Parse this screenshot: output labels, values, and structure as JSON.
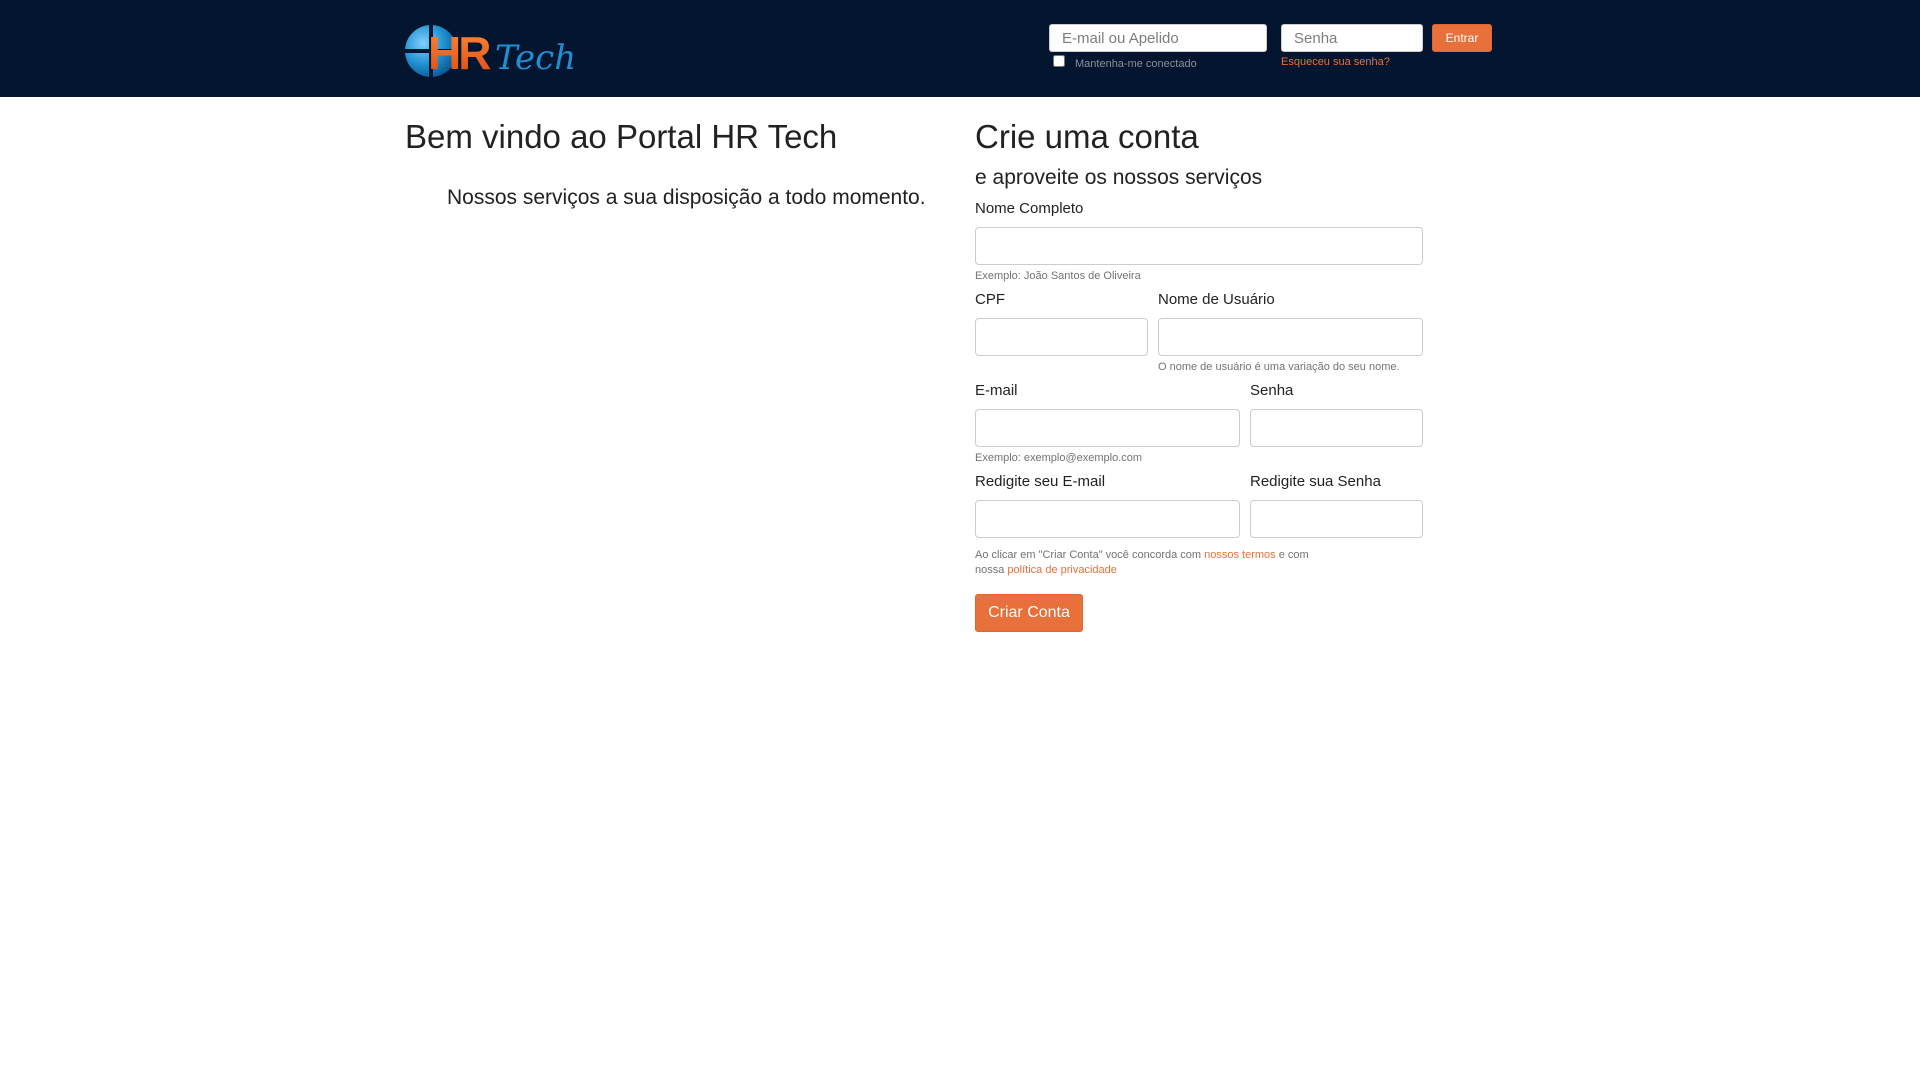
{
  "header": {
    "logo_text": "HRTech",
    "email_placeholder": "E-mail ou Apelido",
    "password_placeholder": "Senha",
    "login_button": "Entrar",
    "remember_label": "Mantenha-me conectado",
    "forgot_link": "Esqueceu sua senha?"
  },
  "welcome": {
    "title": "Bem vindo ao Portal HR Tech",
    "text": "Nossos serviços a sua disposição a todo momento."
  },
  "signup": {
    "title": "Crie uma conta",
    "subtitle": "e aproveite os nossos serviços",
    "full_name": {
      "label": "Nome Completo",
      "help": "Exemplo: João Santos de Oliveira"
    },
    "cpf": {
      "label": "CPF"
    },
    "username": {
      "label": "Nome de Usuário",
      "help": "O nome de usuário é uma variação do seu nome."
    },
    "email": {
      "label": "E-mail",
      "help": "Exemplo: exemplo@exemplo.com"
    },
    "password": {
      "label": "Senha"
    },
    "email_confirm": {
      "label": "Redigite seu E-mail"
    },
    "password_confirm": {
      "label": "Redigite sua Senha"
    },
    "terms": {
      "prefix": "Ao clicar em \"Criar Conta\" você concorda com ",
      "terms_link": "nossos termos",
      "middle": " e com nossa ",
      "privacy_link": "política de privacidade"
    },
    "submit_label": "Criar Conta"
  },
  "colors": {
    "header_background": "#04162f",
    "accent": "#e8703a",
    "logo_blue": "#1f8fd0"
  }
}
